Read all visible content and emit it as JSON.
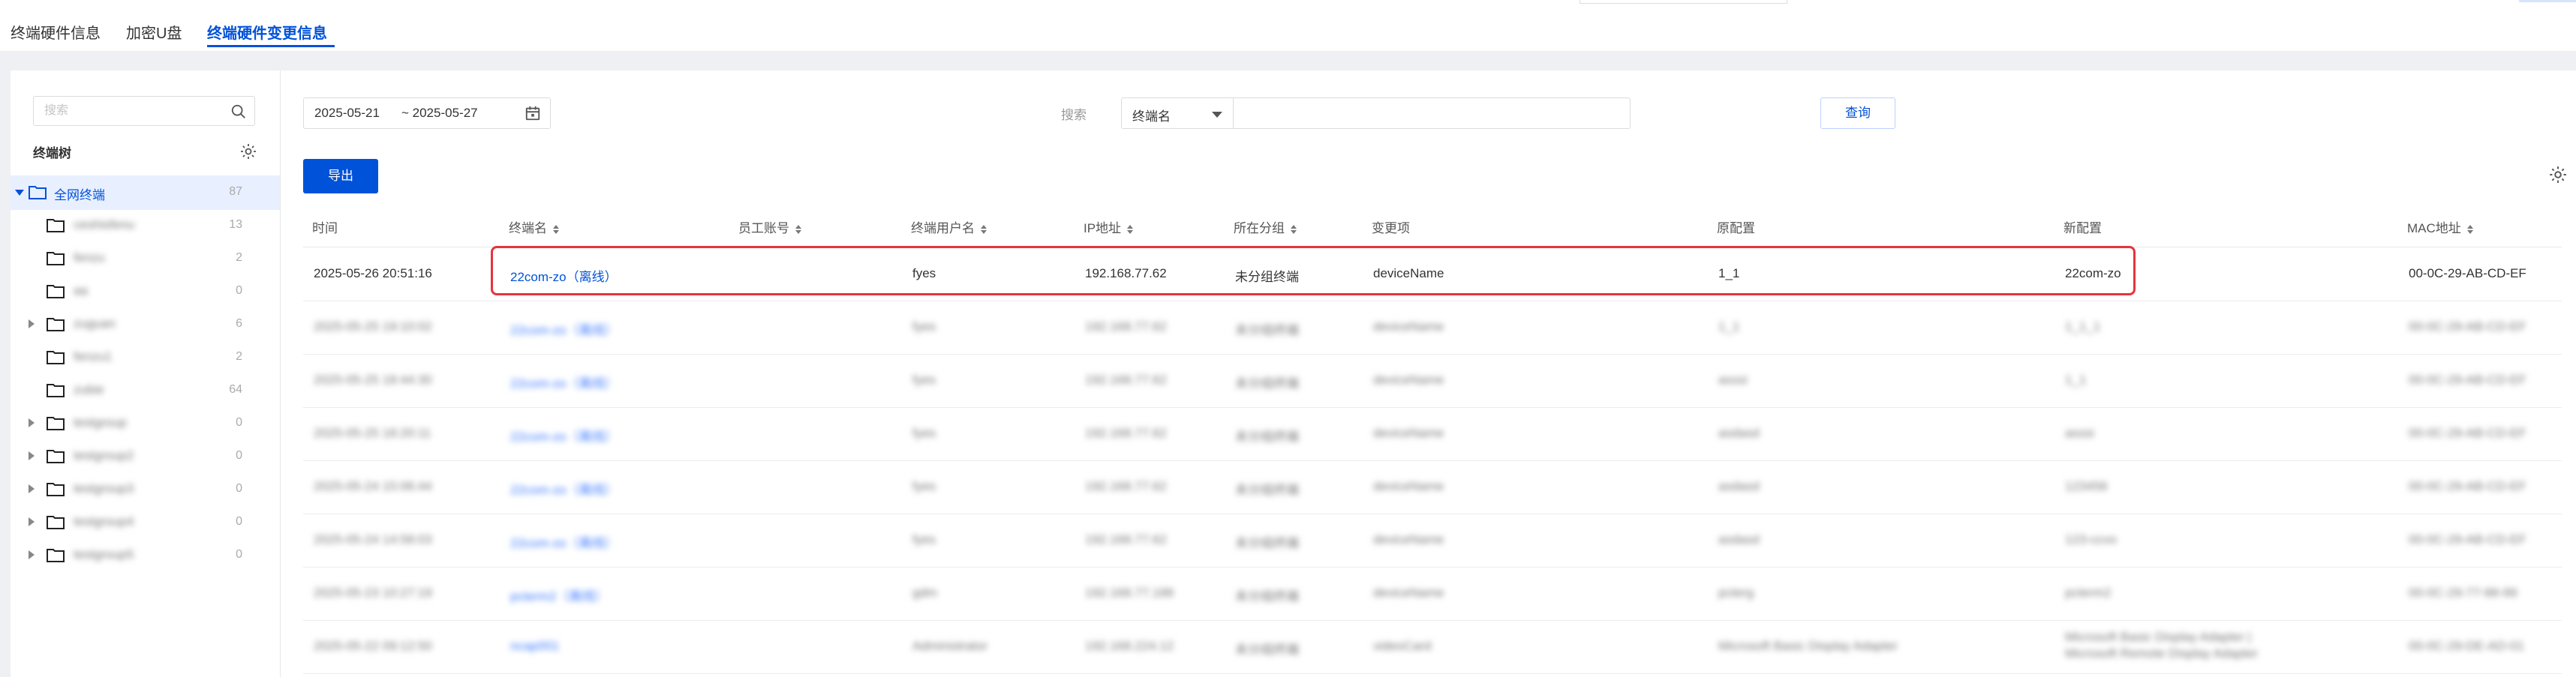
{
  "tabs": [
    {
      "label": "终端硬件信息",
      "active": false
    },
    {
      "label": "加密U盘",
      "active": false
    },
    {
      "label": "终端硬件变更信息",
      "active": true
    }
  ],
  "left_panel": {
    "search_placeholder": "搜索",
    "tree_title": "终端树",
    "tree": [
      {
        "label": "全网终端",
        "count": "87",
        "selected": true,
        "expandable": true,
        "expanded": true,
        "level": 0
      },
      {
        "label": "ceshisfenu",
        "count": "13",
        "blurred": true,
        "expandable": false,
        "level": 1
      },
      {
        "label": "fenzu",
        "count": "2",
        "blurred": true,
        "expandable": false,
        "level": 1
      },
      {
        "label": "aa",
        "count": "0",
        "blurred": true,
        "expandable": false,
        "level": 1
      },
      {
        "label": "zuguan",
        "count": "6",
        "blurred": true,
        "expandable": true,
        "level": 1
      },
      {
        "label": "fenzu1",
        "count": "2",
        "blurred": true,
        "expandable": false,
        "level": 1
      },
      {
        "label": "zubie",
        "count": "64",
        "blurred": true,
        "expandable": false,
        "level": 1
      },
      {
        "label": "testgroup",
        "count": "0",
        "blurred": true,
        "expandable": true,
        "level": 1
      },
      {
        "label": "testgroup2",
        "count": "0",
        "blurred": true,
        "expandable": true,
        "level": 1
      },
      {
        "label": "testgroup3",
        "count": "0",
        "blurred": true,
        "expandable": true,
        "level": 1
      },
      {
        "label": "testgroup4",
        "count": "0",
        "blurred": true,
        "expandable": true,
        "level": 1
      },
      {
        "label": "testgroup5",
        "count": "0",
        "blurred": true,
        "expandable": true,
        "level": 1
      }
    ]
  },
  "filters": {
    "date_start": "2025-05-21",
    "date_end": "~ 2025-05-27",
    "search_label": "搜索",
    "field_select": "终端名",
    "search_value": "",
    "query_button": "查询",
    "export_button": "导出"
  },
  "table": {
    "columns": [
      {
        "label": "时间",
        "sortable": false
      },
      {
        "label": "终端名",
        "sortable": true
      },
      {
        "label": "员工账号",
        "sortable": true
      },
      {
        "label": "终端用户名",
        "sortable": true
      },
      {
        "label": "IP地址",
        "sortable": true
      },
      {
        "label": "所在分组",
        "sortable": true
      },
      {
        "label": "变更项",
        "sortable": false
      },
      {
        "label": "原配置",
        "sortable": false
      },
      {
        "label": "新配置",
        "sortable": false
      },
      {
        "label": "MAC地址",
        "sortable": true
      }
    ],
    "rows": [
      {
        "time": "2025-05-26 20:51:16",
        "terminal": "22com-zo（离线）",
        "account": "",
        "user": "fyes",
        "ip": "192.168.77.62",
        "group": "未分组终端",
        "item": "deviceName",
        "old": "1_1",
        "new": "22com-zo",
        "mac": "00-0C-29-AB-CD-EF",
        "blurred": false
      },
      {
        "time": "2025-05-25 19:10:02",
        "terminal": "22com-zo（离线）",
        "account": "",
        "user": "fyes",
        "ip": "192.168.77.62",
        "group": "未分组终端",
        "item": "deviceName",
        "old": "1_1",
        "new": "1_1_1",
        "mac": "00-0C-29-AB-CD-EF",
        "blurred": true
      },
      {
        "time": "2025-05-25 18:44:30",
        "terminal": "22com-zo（离线）",
        "account": "",
        "user": "fyes",
        "ip": "192.168.77.62",
        "group": "未分组终端",
        "item": "deviceName",
        "old": "asssi",
        "new": "1_1",
        "mac": "00-0C-29-AB-CD-EF",
        "blurred": true
      },
      {
        "time": "2025-05-25 18:20:11",
        "terminal": "22com-zo（离线）",
        "account": "",
        "user": "fyes",
        "ip": "192.168.77.62",
        "group": "未分组终端",
        "item": "deviceName",
        "old": "asdasd",
        "new": "asssi",
        "mac": "00-0C-29-AB-CD-EF",
        "blurred": true
      },
      {
        "time": "2025-05-24 15:06:44",
        "terminal": "22com-zo（离线）",
        "account": "",
        "user": "fyes",
        "ip": "192.168.77.62",
        "group": "未分组终端",
        "item": "deviceName",
        "old": "asdasd",
        "new": "123456",
        "mac": "00-0C-29-AB-CD-EF",
        "blurred": true
      },
      {
        "time": "2025-05-24 14:58:03",
        "terminal": "22com-zo（离线）",
        "account": "",
        "user": "fyes",
        "ip": "192.168.77.62",
        "group": "未分组终端",
        "item": "deviceName",
        "old": "asdasd",
        "new": "123-ccvo",
        "mac": "00-0C-29-AB-CD-EF",
        "blurred": true
      },
      {
        "time": "2025-05-23 10:27:19",
        "terminal": "pcterm2（离线）",
        "account": "",
        "user": "gdm",
        "ip": "192.168.77.188",
        "group": "未分组终端",
        "item": "deviceName",
        "old": "pcterg",
        "new": "pcterm2",
        "mac": "00-0C-29-77-88-99",
        "blurred": true
      },
      {
        "time": "2025-05-22 09:12:50",
        "terminal": "ncap001",
        "account": "",
        "user": "Administrator",
        "ip": "192.168.224.12",
        "group": "未分组终端",
        "item": "videoCard",
        "old": "Microsoft Basic Display Adapter",
        "new": "Microsoft Basic Display Adapter |",
        "new2": "Microsoft Remote Display Adapter",
        "mac": "00-0C-29-DE-AD-01",
        "blurred": true
      }
    ]
  },
  "colors": {
    "accent": "#0052d9",
    "highlight": "#e5343d",
    "selected_row": "#e8efff"
  },
  "icons": [
    "search-icon",
    "gear-icon",
    "folder-icon",
    "calendar-icon",
    "chevron-down-icon",
    "sort-icon"
  ]
}
